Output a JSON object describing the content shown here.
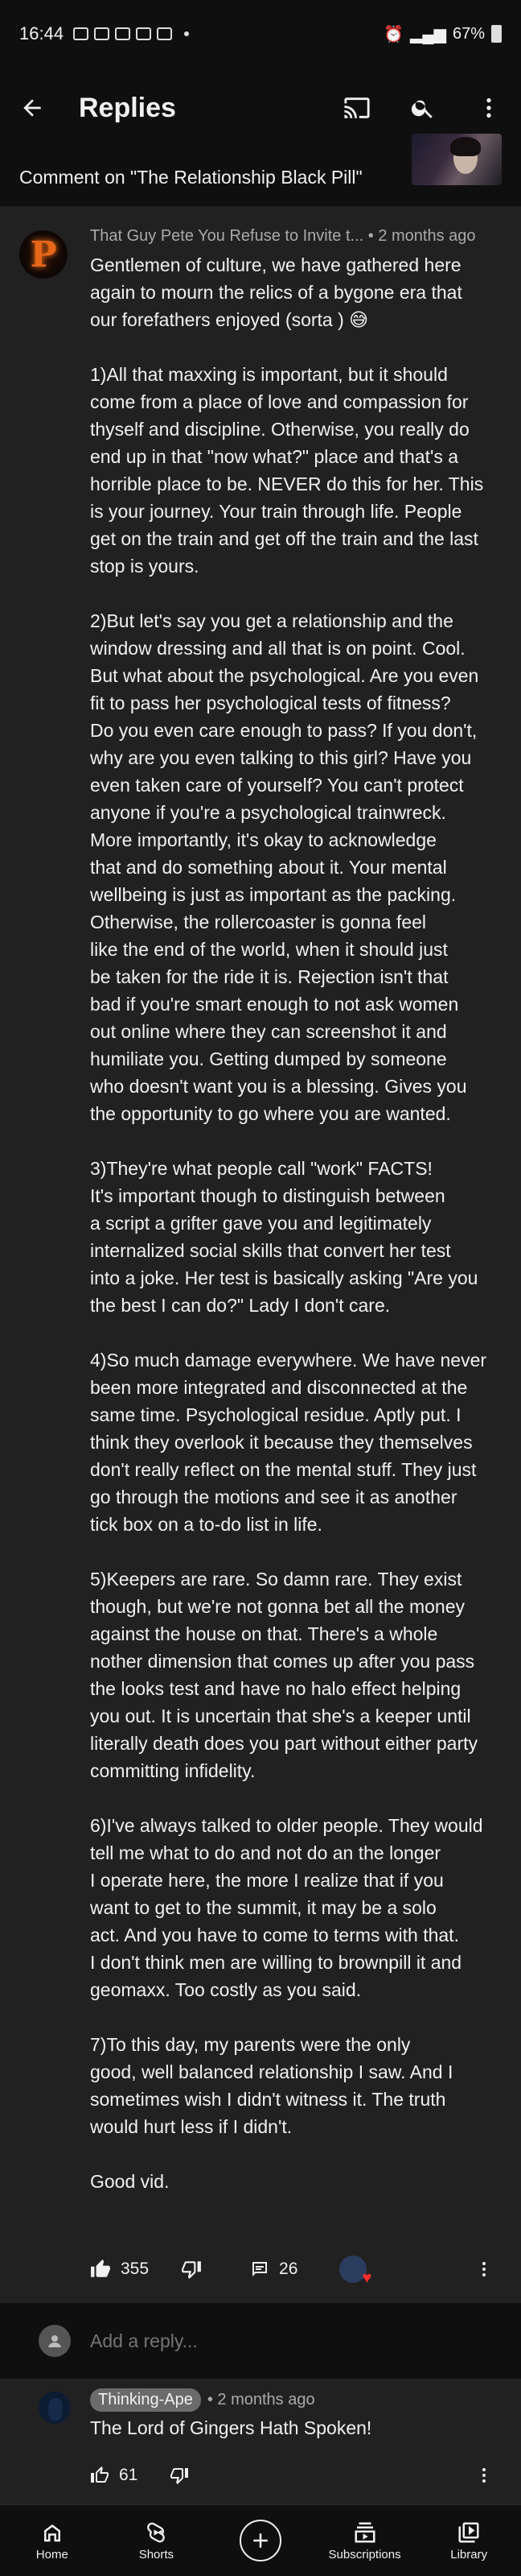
{
  "status_bar": {
    "time": "16:44",
    "battery": "67%"
  },
  "app_bar": {
    "title": "Replies"
  },
  "context": {
    "text": "Comment on \"The Relationship Black Pill\""
  },
  "comment": {
    "author": "That Guy Pete You Refuse to Invite t...",
    "time": "• 2 months ago",
    "paragraphs": [
      [
        "Gentlemen of culture, we have gathered here",
        "again to mourn the relics of a bygone era that",
        "our forefathers enjoyed (sorta ) 😅"
      ],
      [
        "1)All that maxxing is important, but it should",
        "come from a place of love and compassion for",
        "thyself and discipline. Otherwise, you really do",
        "end up in that \"now what?\" place and that's a",
        "horrible place to be. NEVER do this for her. This",
        "is your journey. Your train through life. People",
        "get on the train and get off the train and the last",
        "stop is yours."
      ],
      [
        "2)But let's say you get a relationship and the",
        "window dressing and all that is on point. Cool.",
        "But what about the psychological. Are you even",
        "fit to pass her psychological tests of fitness?",
        "Do you even care enough to pass? If you don't,",
        "why are you even talking to this girl?  Have you",
        "even taken care of yourself? You can't protect",
        "anyone if you're a psychological trainwreck.",
        "More importantly, it's okay to acknowledge",
        "that and do something about it.  Your mental",
        "wellbeing is just as important as the packing.",
        "Otherwise, the rollercoaster is gonna feel",
        "like the end of the world, when it should just",
        "be taken for the ride it is. Rejection isn't that",
        "bad if you're smart enough to not ask women",
        "out online where they can screenshot it and",
        "humiliate you.  Getting dumped by someone",
        "who doesn't want you is a blessing. Gives you",
        "the opportunity to go where you are wanted."
      ],
      [
        "3)They're what people call \"work\" FACTS!",
        "It's important though to distinguish between",
        "a script a grifter gave you and legitimately",
        "internalized social skills that convert her test",
        "into a joke. Her test is basically asking \"Are you",
        "the best I can do?\" Lady I don't care."
      ],
      [
        "4)So much damage everywhere. We have never",
        "been more integrated and disconnected at the",
        "same time. Psychological residue. Aptly put. I",
        "think they overlook it because they themselves",
        "don't really reflect on the mental stuff. They just",
        "go through the motions and see it as another",
        "tick box on a to-do list in life."
      ],
      [
        "5)Keepers are rare. So damn rare. They exist",
        "though, but we're not gonna bet all the money",
        "against the house on that. There's a whole",
        "nother dimension that comes up after you pass",
        "the looks test and have no halo effect helping",
        "you out. It is uncertain that she's a keeper until",
        "literally death does you part without either party",
        "committing infidelity."
      ],
      [
        "6)I've always talked to older people. They would",
        "tell me what to do and not do an the longer",
        "I operate here, the more I realize that if you",
        "want to get to the summit, it may be a solo",
        "act. And you have to come to terms with that.",
        "I don't think men are willing to brownpill it and",
        "geomaxx.  Too costly as you said."
      ],
      [
        "7)To this day, my parents were the only",
        "good, well balanced relationship I saw.  And I",
        "sometimes wish I didn't witness it. The truth",
        "would hurt less if I didn't."
      ],
      [
        "Good vid."
      ]
    ],
    "likes": "355",
    "replies": "26"
  },
  "reply_input": {
    "placeholder": "Add a reply..."
  },
  "reply": {
    "author": "Thinking-Ape",
    "time": "• 2 months ago",
    "text": "The Lord of Gingers Hath Spoken!",
    "likes": "61"
  },
  "bottom_nav": [
    {
      "label": "Home",
      "icon": "home-icon"
    },
    {
      "label": "Shorts",
      "icon": "shorts-icon"
    },
    {
      "label": "",
      "icon": "create-icon"
    },
    {
      "label": "Subscriptions",
      "icon": "subscriptions-icon"
    },
    {
      "label": "Library",
      "icon": "library-icon"
    }
  ]
}
